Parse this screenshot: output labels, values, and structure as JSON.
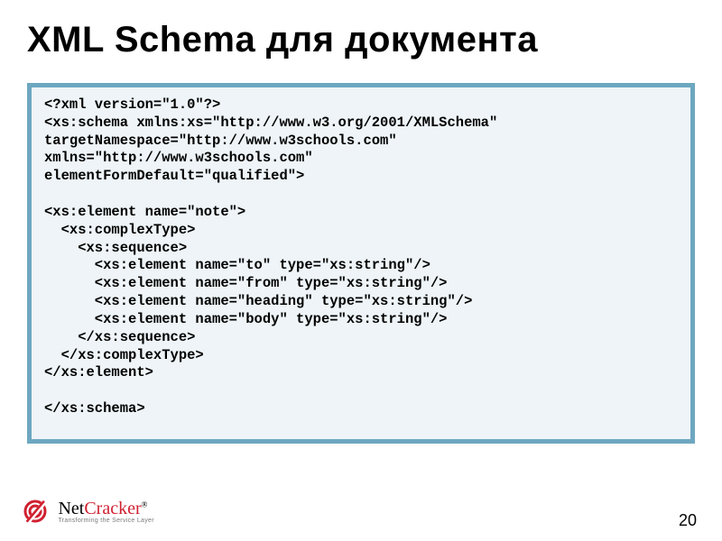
{
  "slide": {
    "title": "XML Schema для документа",
    "page_number": "20"
  },
  "code": {
    "lines": [
      "<?xml version=\"1.0\"?>",
      "<xs:schema xmlns:xs=\"http://www.w3.org/2001/XMLSchema\"",
      "targetNamespace=\"http://www.w3schools.com\"",
      "xmlns=\"http://www.w3schools.com\"",
      "elementFormDefault=\"qualified\">",
      "",
      "<xs:element name=\"note\">",
      "  <xs:complexType>",
      "    <xs:sequence>",
      "      <xs:element name=\"to\" type=\"xs:string\"/>",
      "      <xs:element name=\"from\" type=\"xs:string\"/>",
      "      <xs:element name=\"heading\" type=\"xs:string\"/>",
      "      <xs:element name=\"body\" type=\"xs:string\"/>",
      "    </xs:sequence>",
      "  </xs:complexType>",
      "</xs:element>",
      "",
      "</xs:schema>"
    ]
  },
  "logo": {
    "brand_part1": "Net",
    "brand_part2": "Cracker",
    "reg": "®",
    "tagline": "Transforming the Service Layer"
  },
  "colors": {
    "code_border": "#6da7c0",
    "code_bg": "#eef4f7"
  }
}
